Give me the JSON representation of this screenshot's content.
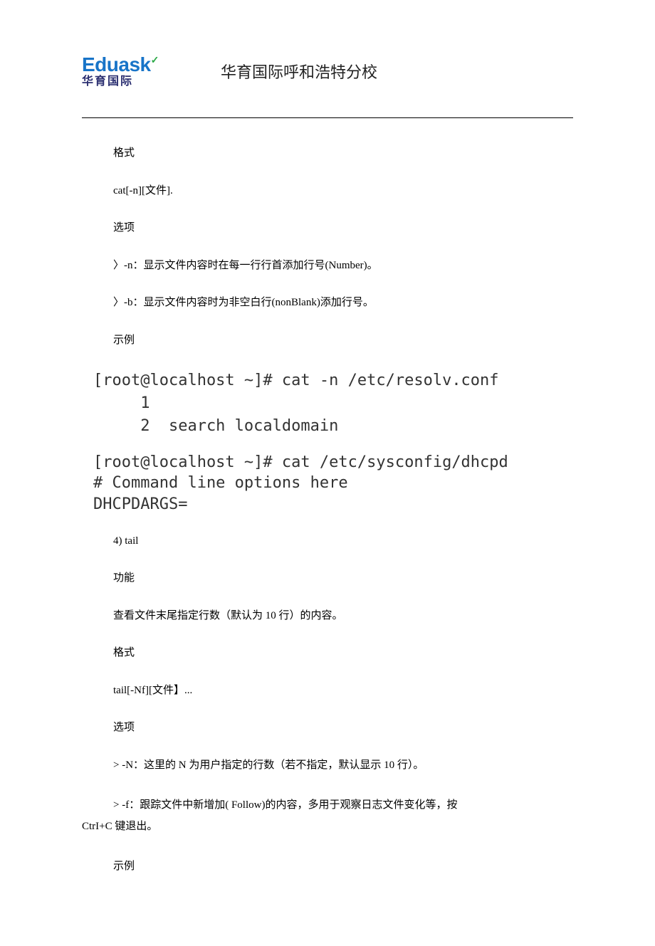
{
  "header": {
    "logo_top": "Eduask",
    "logo_bottom": "华育国际",
    "title": "华育国际呼和浩特分校"
  },
  "content": {
    "p1": "格式",
    "p2": "cat[-n][文件].",
    "p3": "选项",
    "p4": "〉-n：显示文件内容时在每一行行首添加行号(Number)。",
    "p5": "〉-b：显示文件内容时为非空白行(nonBlank)添加行号。",
    "p6": "示例",
    "code1": {
      "l1": "[root@localhost ~]# cat -n /etc/resolv.conf",
      "l2": "     1",
      "l3": "     2  search localdomain"
    },
    "code2": {
      "l1": "[root@localhost ~]# cat /etc/sysconfig/dhcpd",
      "l2": "# Command line options here",
      "l3": "DHCPDARGS="
    },
    "p7": "4)  tail",
    "p8": "功能",
    "p9": "查看文件末尾指定行数（默认为 10 行）的内容。",
    "p10": "格式",
    "p11": "tail[-Nf][文件】...",
    "p12": "选项",
    "p13": "> -N：这里的 N 为用户指定的行数（若不指定，默认显示 10 行）。",
    "p14a": "> -f：跟踪文件中新增加( Follow)的内容，多用于观察日志文件变化等，按",
    "p14b": "CtrI+C 键退出。",
    "p15": "示例"
  }
}
